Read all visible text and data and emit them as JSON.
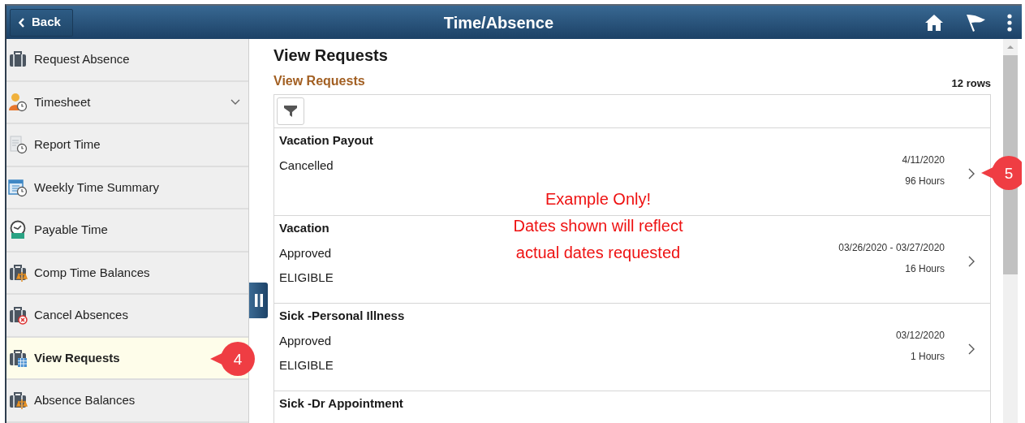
{
  "header": {
    "back": "Back",
    "title": "Time/Absence"
  },
  "sidebar": {
    "items": [
      {
        "label": "Request Absence",
        "kind": "link",
        "selected": false
      },
      {
        "label": "Timesheet",
        "kind": "group",
        "selected": false
      },
      {
        "label": "Report Time",
        "kind": "link",
        "selected": false
      },
      {
        "label": "Weekly Time Summary",
        "kind": "link",
        "selected": false
      },
      {
        "label": "Payable Time",
        "kind": "link",
        "selected": false
      },
      {
        "label": "Comp Time Balances",
        "kind": "link",
        "selected": false
      },
      {
        "label": "Cancel Absences",
        "kind": "link",
        "selected": false
      },
      {
        "label": "View Requests",
        "kind": "link",
        "selected": true,
        "callout": "4"
      },
      {
        "label": "Absence Balances",
        "kind": "link",
        "selected": false
      }
    ]
  },
  "page": {
    "title": "View Requests",
    "section": "View Requests",
    "row_count": "12 rows"
  },
  "requests": [
    {
      "title": "Vacation Payout",
      "status": "Cancelled",
      "date": "4/11/2020",
      "hours": "96 Hours",
      "callout": "5"
    },
    {
      "title": "Vacation",
      "status": "Approved",
      "eligibility": "ELIGIBLE",
      "date": "03/26/2020 - 03/27/2020",
      "hours": "16 Hours"
    },
    {
      "title": "Sick -Personal Illness",
      "status": "Approved",
      "eligibility": "ELIGIBLE",
      "date": "03/12/2020",
      "hours": "1 Hours"
    },
    {
      "title": "Sick -Dr Appointment"
    }
  ],
  "annotation": [
    "Example Only!",
    "Dates shown will reflect",
    "actual dates requested"
  ]
}
